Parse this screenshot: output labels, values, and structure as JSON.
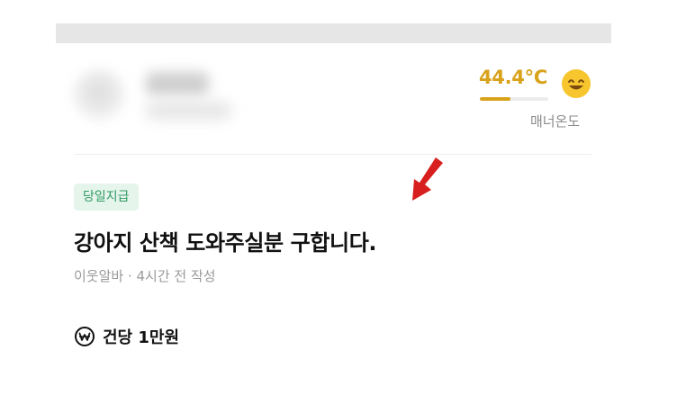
{
  "profile": {
    "manner_temperature": "44.4°C",
    "manner_temperature_fill": 0.444,
    "manner_label": "매너온도",
    "emoji": "smiling-face-icon"
  },
  "post": {
    "badge": "당일지급",
    "title": "강아지 산책 도와주실분 구합니다.",
    "meta": "이웃알바 · 4시간 전 작성",
    "price": "건당 1만원",
    "price_icon": "won-coin-icon"
  },
  "colors": {
    "accent_temperature": "#d9a21b",
    "badge_bg": "#e6f5ec",
    "badge_text": "#2f9a62",
    "annotation_arrow": "#d81f1f"
  }
}
